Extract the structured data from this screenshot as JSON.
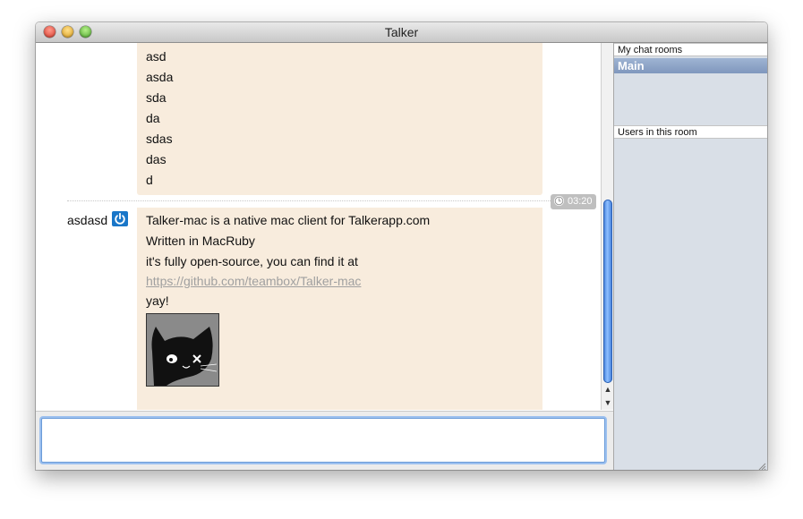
{
  "window": {
    "title": "Talker"
  },
  "chat": {
    "messages_top": [
      "asd",
      "asda",
      "sda",
      "da",
      "sdas",
      "das",
      "d"
    ],
    "timestamp": "03:20",
    "message": {
      "username": "asdasd",
      "lines": [
        "Talker-mac is a native mac client for Talkerapp.com",
        "Written in MacRuby",
        "it's fully open-source, you can find it at"
      ],
      "link": "https://github.com/teambox/Talker-mac",
      "closing": "yay!"
    }
  },
  "input": {
    "placeholder": ""
  },
  "sidebar": {
    "rooms_header": "My chat rooms",
    "rooms": [
      {
        "label": "Main",
        "selected": true
      }
    ],
    "users_header": "Users in this room"
  },
  "colors": {
    "message_bg": "#f8ecdd",
    "selection": "#8aa2c6",
    "status_icon": "#1976c8"
  },
  "icons": {
    "status": "power-icon",
    "clock": "clock-icon",
    "avatar_image": "cat-image"
  }
}
